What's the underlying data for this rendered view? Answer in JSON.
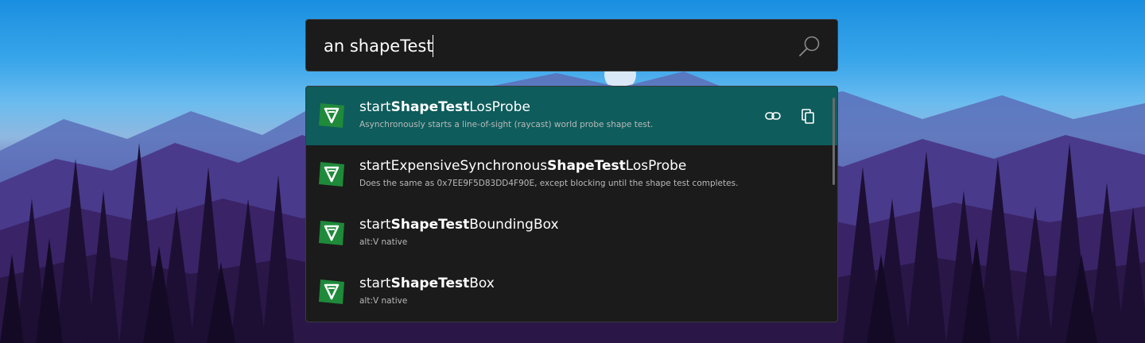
{
  "search": {
    "query": "an shapeTest",
    "icon": "search-icon"
  },
  "results": [
    {
      "title_prefix": "start",
      "title_match": "ShapeTest",
      "title_suffix": "LosProbe",
      "subtitle": "Asynchronously starts a line-of-sight (raycast) world probe shape test.",
      "selected": true,
      "icon": "altv-logo-icon"
    },
    {
      "title_prefix": "startExpensiveSynchronous",
      "title_match": "ShapeTest",
      "title_suffix": "LosProbe",
      "subtitle": "Does the same as 0x7EE9F5D83DD4F90E, except blocking until the shape test completes.",
      "selected": false,
      "icon": "altv-logo-icon"
    },
    {
      "title_prefix": "start",
      "title_match": "ShapeTest",
      "title_suffix": "BoundingBox",
      "subtitle": "alt:V native",
      "selected": false,
      "icon": "altv-logo-icon"
    },
    {
      "title_prefix": "start",
      "title_match": "ShapeTest",
      "title_suffix": "Box",
      "subtitle": "alt:V native",
      "selected": false,
      "icon": "altv-logo-icon"
    }
  ],
  "actions": {
    "link_icon": "link-icon",
    "copy_icon": "copy-icon"
  },
  "colors": {
    "selected_row": "#0f5c5c",
    "panel_bg": "#1b1b1b",
    "logo_green": "#1e8a3a"
  }
}
